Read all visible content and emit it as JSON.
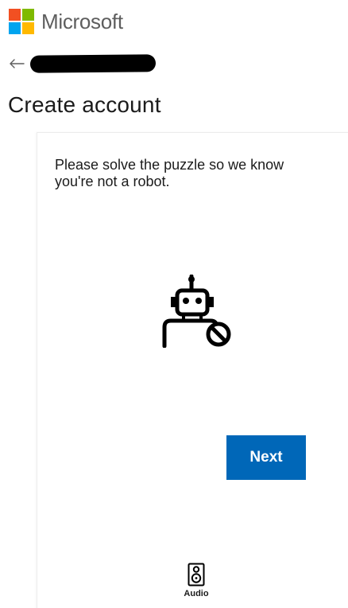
{
  "brand": {
    "name": "Microsoft",
    "logo_colors": [
      "#f25022",
      "#7fba00",
      "#00a4ef",
      "#ffb900"
    ]
  },
  "identity": {
    "back_icon": "arrow-left-icon"
  },
  "header": {
    "title": "Create account"
  },
  "challenge": {
    "prompt": "Please solve the puzzle so we know you're not a robot.",
    "robot_icon": "robot-blocked-icon",
    "next_label": "Next",
    "audio_icon": "speaker-icon",
    "audio_label": "Audio"
  },
  "colors": {
    "accent": "#0067b8",
    "text": "#1b1b1b",
    "brand_text": "#5e5e5e"
  }
}
